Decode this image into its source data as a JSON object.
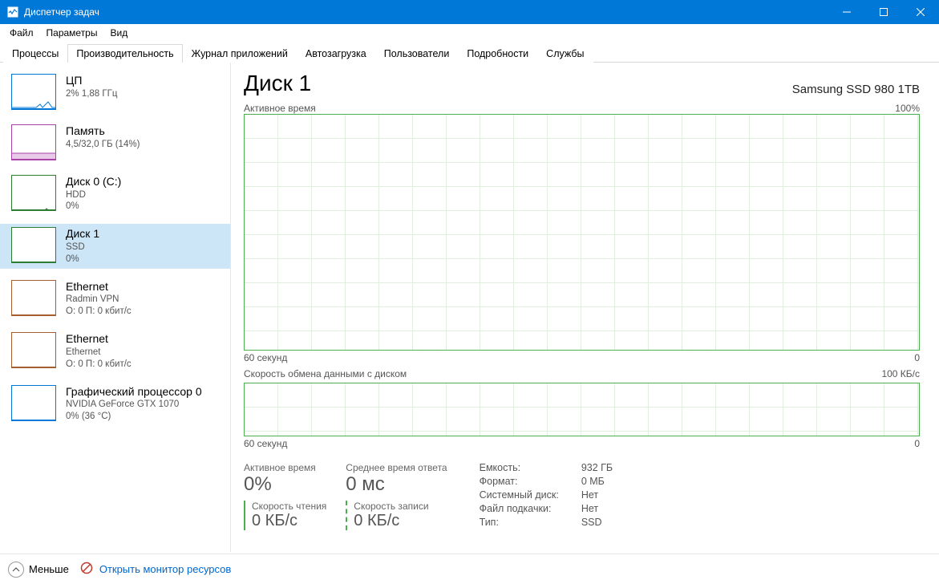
{
  "window": {
    "title": "Диспетчер задач"
  },
  "menu": {
    "file": "Файл",
    "options": "Параметры",
    "view": "Вид"
  },
  "tabs": {
    "processes": "Процессы",
    "performance": "Производительность",
    "apphistory": "Журнал приложений",
    "startup": "Автозагрузка",
    "users": "Пользователи",
    "details": "Подробности",
    "services": "Службы"
  },
  "sidebar": {
    "cpu": {
      "title": "ЦП",
      "sub": "2% 1,88 ГГц"
    },
    "mem": {
      "title": "Память",
      "sub": "4,5/32,0 ГБ (14%)"
    },
    "disk0": {
      "title": "Диск 0 (C:)",
      "sub1": "HDD",
      "sub2": "0%"
    },
    "disk1": {
      "title": "Диск 1",
      "sub1": "SSD",
      "sub2": "0%"
    },
    "eth0": {
      "title": "Ethernet",
      "sub1": "Radmin VPN",
      "sub2": "О: 0 П: 0 кбит/с"
    },
    "eth1": {
      "title": "Ethernet",
      "sub1": "Ethernet",
      "sub2": "О: 0 П: 0 кбит/с"
    },
    "gpu": {
      "title": "Графический процессор 0",
      "sub1": "NVIDIA GeForce GTX 1070",
      "sub2": "0% (36 °C)"
    }
  },
  "main": {
    "title": "Диск 1",
    "model": "Samsung SSD 980 1TB",
    "active_label": "Активное время",
    "active_max": "100%",
    "axis_left": "60 секунд",
    "axis_right": "0",
    "transfer_label": "Скорость обмена данными с диском",
    "transfer_max": "100 КБ/с"
  },
  "stats": {
    "active_label": "Активное время",
    "active_value": "0%",
    "response_label": "Среднее время ответа",
    "response_value": "0 мс",
    "read_label": "Скорость чтения",
    "read_value": "0 КБ/с",
    "write_label": "Скорость записи",
    "write_value": "0 КБ/с",
    "capacity_label": "Емкость:",
    "capacity_value": "932 ГБ",
    "format_label": "Формат:",
    "format_value": "0 МБ",
    "system_label": "Системный диск:",
    "system_value": "Нет",
    "page_label": "Файл подкачки:",
    "page_value": "Нет",
    "type_label": "Тип:",
    "type_value": "SSD"
  },
  "footer": {
    "fewer": "Меньше",
    "resmon": "Открыть монитор ресурсов"
  },
  "chart_data": {
    "active_time": {
      "type": "line",
      "ylabel": "%",
      "ylim": [
        0,
        100
      ],
      "x_range_seconds": 60,
      "values": [
        0,
        0,
        0,
        0,
        0,
        0,
        0,
        0,
        0,
        0,
        0,
        0,
        0,
        0,
        0,
        0,
        0,
        0,
        0,
        0
      ]
    },
    "transfer": {
      "type": "line",
      "ylabel": "КБ/с",
      "ylim": [
        0,
        100
      ],
      "x_range_seconds": 60,
      "series": [
        {
          "name": "read",
          "values": [
            0,
            0,
            0,
            0,
            0,
            0,
            0,
            0,
            0,
            0,
            0,
            0,
            0,
            0,
            0,
            0,
            0,
            0,
            0,
            0
          ]
        },
        {
          "name": "write",
          "values": [
            0,
            0,
            0,
            0,
            0,
            0,
            0,
            0,
            0,
            0,
            0,
            0,
            0,
            0,
            0,
            0,
            0,
            0,
            0,
            0
          ]
        }
      ]
    }
  }
}
